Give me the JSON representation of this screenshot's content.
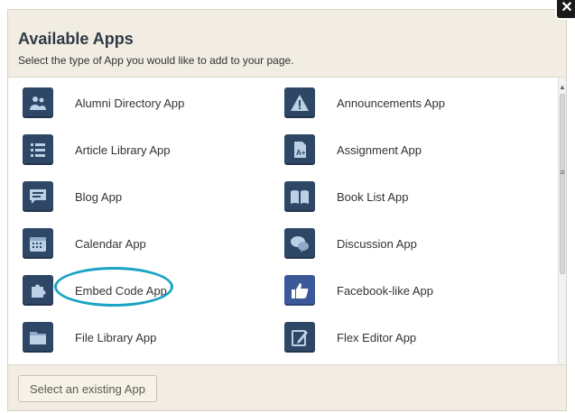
{
  "dialog": {
    "title": "Available Apps",
    "subtitle": "Select the type of App you would like to add to your page.",
    "close_symbol": "✕"
  },
  "apps": [
    {
      "label": "Alumni Directory App",
      "icon": "people-icon"
    },
    {
      "label": "Announcements App",
      "icon": "warning-triangle-icon"
    },
    {
      "label": "Article Library App",
      "icon": "list-icon"
    },
    {
      "label": "Assignment App",
      "icon": "grade-document-icon"
    },
    {
      "label": "Blog App",
      "icon": "speech-bubble-icon"
    },
    {
      "label": "Book List App",
      "icon": "open-book-icon"
    },
    {
      "label": "Calendar App",
      "icon": "calendar-icon"
    },
    {
      "label": "Discussion App",
      "icon": "discussion-bubbles-icon"
    },
    {
      "label": "Embed Code App",
      "icon": "puzzle-piece-icon"
    },
    {
      "label": "Facebook-like App",
      "icon": "thumbs-up-icon"
    },
    {
      "label": "File Library App",
      "icon": "folder-icon"
    },
    {
      "label": "Flex Editor App",
      "icon": "edit-pencil-icon"
    }
  ],
  "footer": {
    "select_existing_label": "Select an existing App"
  },
  "colors": {
    "tile": "#2e4766",
    "facebook_tile": "#3b5998",
    "highlight": "#1aa3c3"
  },
  "scrollbar": {
    "up_arrow": "▲",
    "grip": "≡"
  }
}
